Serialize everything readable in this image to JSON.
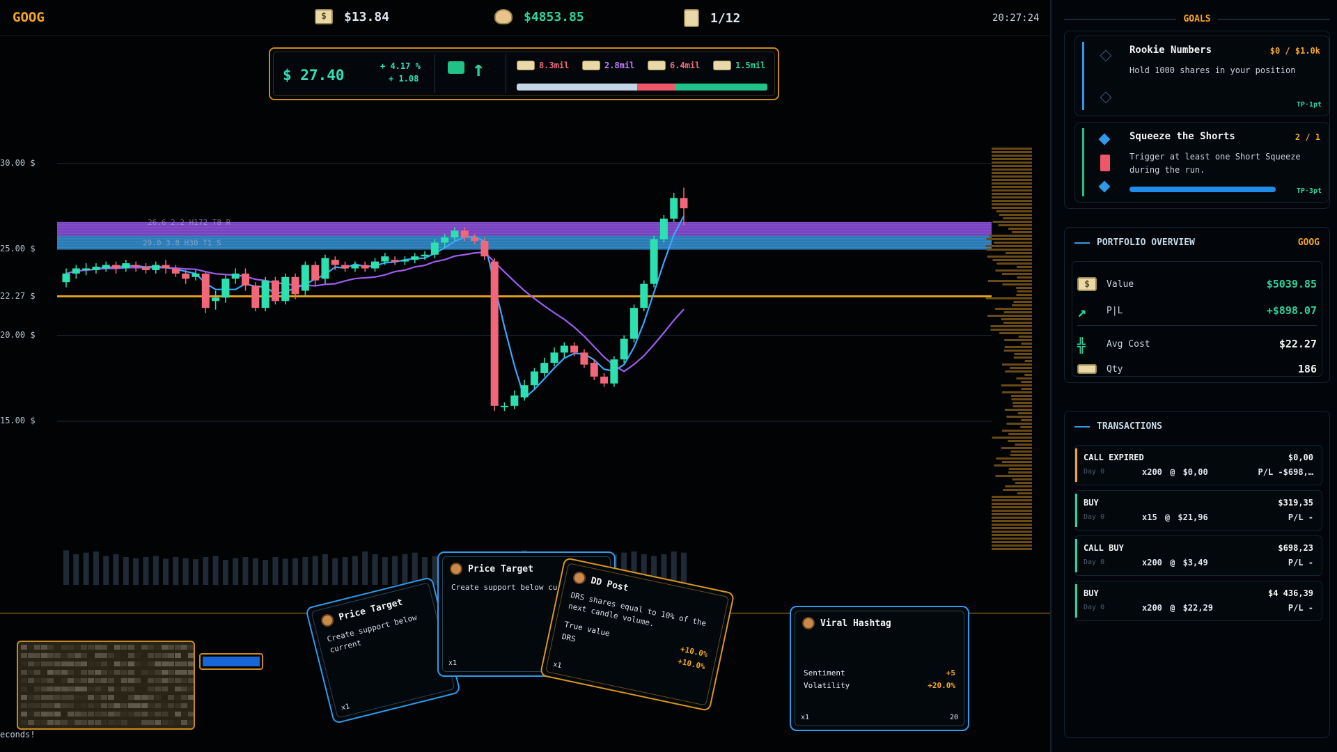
{
  "topbar": {
    "ticker": "GOOG",
    "cash": "$13.84",
    "net_worth": "$4853.85",
    "day": "1/12",
    "clock": "20:27:24",
    "icons": [
      "dollar-bill-icon",
      "money-bag-icon",
      "calendar-icon"
    ]
  },
  "price_panel": {
    "price": "$ 27.40",
    "change_pct": "+ 4.17 %",
    "change_abs": "+ 1.08",
    "trend": "up",
    "pools": [
      {
        "label": "8.3mil",
        "color": "#f06a7a"
      },
      {
        "label": "2.8mil",
        "color": "#c77dff"
      },
      {
        "label": "6.4mil",
        "color": "#f06a7a"
      },
      {
        "label": "1.5mil",
        "color": "#2fd39a"
      }
    ],
    "pool_bar": [
      {
        "fraction": 0.48,
        "color": "#c3d6e6"
      },
      {
        "fraction": 0.15,
        "color": "#f0566a"
      },
      {
        "fraction": 0.37,
        "color": "#21c287"
      }
    ]
  },
  "chart_data": {
    "type": "candlestick",
    "y_ticks": [
      {
        "value": 30,
        "label": "30.00 $"
      },
      {
        "value": 25,
        "label": "25.00 $"
      },
      {
        "value": 22.27,
        "label": "22.27 $"
      },
      {
        "value": 20,
        "label": "20.00 $"
      },
      {
        "value": 15,
        "label": "15.00 $"
      }
    ],
    "avg_cost_line": 22.27,
    "zones": [
      {
        "label": "26.6 2.2 H172 T8 R",
        "low": 25.8,
        "high": 26.6,
        "color": "#8d4ce0"
      },
      {
        "label": "29.0 3.8 H30 T1 S",
        "low": 25.0,
        "high": 25.8,
        "color": "#2f8fd6"
      }
    ],
    "candles": [
      [
        23.1,
        23.6,
        22.8,
        23.9
      ],
      [
        23.6,
        23.9,
        23.3,
        24.1
      ],
      [
        23.8,
        23.9,
        23.5,
        24.2
      ],
      [
        23.8,
        24.0,
        23.6,
        24.2
      ],
      [
        23.9,
        24.1,
        23.7,
        24.3
      ],
      [
        24.1,
        23.9,
        23.6,
        24.3
      ],
      [
        23.9,
        24.2,
        23.7,
        24.4
      ],
      [
        24.1,
        24.0,
        23.7,
        24.3
      ],
      [
        24.0,
        23.8,
        23.6,
        24.2
      ],
      [
        23.8,
        24.1,
        23.6,
        24.3
      ],
      [
        24.1,
        23.9,
        23.6,
        24.4
      ],
      [
        23.9,
        23.6,
        23.4,
        24.1
      ],
      [
        23.6,
        23.3,
        23.0,
        23.8
      ],
      [
        23.4,
        23.6,
        23.2,
        23.8
      ],
      [
        23.6,
        21.6,
        21.3,
        23.7
      ],
      [
        22.0,
        22.2,
        21.5,
        22.6
      ],
      [
        22.2,
        23.3,
        21.9,
        23.5
      ],
      [
        23.3,
        23.6,
        23.0,
        23.9
      ],
      [
        23.6,
        22.9,
        22.6,
        23.9
      ],
      [
        22.9,
        21.6,
        21.4,
        23.1
      ],
      [
        21.6,
        23.2,
        21.4,
        23.4
      ],
      [
        23.2,
        22.0,
        21.8,
        23.4
      ],
      [
        22.0,
        23.4,
        21.8,
        23.6
      ],
      [
        23.4,
        22.4,
        22.1,
        23.6
      ],
      [
        22.6,
        24.1,
        22.3,
        24.3
      ],
      [
        24.1,
        23.2,
        22.9,
        24.3
      ],
      [
        23.3,
        24.5,
        23.0,
        24.7
      ],
      [
        24.4,
        24.1,
        23.8,
        24.6
      ],
      [
        24.1,
        23.9,
        23.7,
        24.3
      ],
      [
        23.9,
        24.1,
        23.7,
        24.3
      ],
      [
        24.1,
        23.9,
        23.7,
        24.3
      ],
      [
        23.9,
        24.3,
        23.7,
        24.5
      ],
      [
        24.3,
        24.6,
        24.1,
        24.8
      ],
      [
        24.4,
        24.3,
        24.1,
        24.6
      ],
      [
        24.3,
        24.4,
        24.1,
        24.6
      ],
      [
        24.4,
        24.6,
        24.2,
        24.8
      ],
      [
        24.6,
        24.7,
        24.4,
        24.9
      ],
      [
        24.7,
        25.4,
        24.5,
        25.6
      ],
      [
        25.4,
        25.7,
        25.1,
        25.9
      ],
      [
        25.7,
        26.1,
        25.5,
        26.3
      ],
      [
        26.1,
        25.7,
        25.5,
        26.3
      ],
      [
        25.7,
        25.5,
        25.3,
        25.9
      ],
      [
        25.5,
        24.6,
        24.4,
        25.7
      ],
      [
        24.3,
        15.9,
        15.6,
        24.5
      ],
      [
        15.9,
        15.9,
        15.6,
        16.1
      ],
      [
        15.9,
        16.5,
        15.7,
        16.8
      ],
      [
        16.4,
        17.1,
        16.2,
        17.4
      ],
      [
        17.1,
        17.9,
        16.9,
        18.1
      ],
      [
        17.8,
        18.4,
        17.6,
        18.7
      ],
      [
        18.4,
        19.0,
        18.2,
        19.3
      ],
      [
        19.0,
        19.4,
        18.7,
        19.6
      ],
      [
        19.4,
        19.0,
        18.8,
        19.6
      ],
      [
        19.0,
        18.3,
        18.1,
        19.2
      ],
      [
        18.4,
        17.6,
        17.4,
        18.6
      ],
      [
        17.6,
        17.2,
        17.0,
        17.8
      ],
      [
        17.2,
        18.6,
        17.0,
        18.8
      ],
      [
        18.6,
        19.8,
        18.4,
        20.0
      ],
      [
        19.8,
        21.6,
        19.6,
        21.8
      ],
      [
        21.6,
        23.0,
        21.4,
        23.2
      ],
      [
        23.0,
        25.6,
        22.8,
        25.8
      ],
      [
        25.6,
        26.8,
        25.4,
        27.0
      ],
      [
        26.8,
        28.0,
        26.6,
        28.3
      ],
      [
        28.0,
        27.4,
        26.4,
        28.6
      ]
    ],
    "volume": [
      0.62,
      0.55,
      0.58,
      0.6,
      0.52,
      0.55,
      0.5,
      0.48,
      0.5,
      0.52,
      0.47,
      0.5,
      0.48,
      0.46,
      0.5,
      0.52,
      0.45,
      0.48,
      0.5,
      0.48,
      0.45,
      0.5,
      0.47,
      0.48,
      0.5,
      0.52,
      0.55,
      0.48,
      0.5,
      0.52,
      0.6,
      0.55,
      0.5,
      0.52,
      0.55,
      0.58,
      0.5,
      0.52,
      0.55,
      0.5,
      0.48,
      0.52,
      0.5,
      0.55,
      0.58,
      0.6,
      0.62,
      0.55,
      0.5,
      0.52,
      0.55,
      0.58,
      0.6,
      0.55,
      0.52,
      0.55,
      0.58,
      0.6,
      0.55,
      0.52,
      0.55,
      0.6,
      0.58
    ]
  },
  "cards": [
    {
      "title": "Price Target",
      "desc": "Create support below current",
      "foot": "x1"
    },
    {
      "title": "Price Target",
      "desc": "Create support below current",
      "foot": "x1"
    },
    {
      "title": "DD Post",
      "desc": "DRS shares equal to 10% of the next candle volume.",
      "rows": [
        {
          "label": "True value",
          "value": "+10.0%"
        },
        {
          "label": "DRS",
          "value": "+10.0%"
        }
      ],
      "foot": "x1"
    },
    {
      "title": "Viral Hashtag",
      "rows": [
        {
          "label": "Sentiment",
          "value": "+5"
        },
        {
          "label": "Volatility",
          "value": "+20.0%"
        }
      ],
      "foot": "x1",
      "count": "20"
    }
  ],
  "footer": {
    "status": "econds!"
  },
  "goals": {
    "header": "GOALS",
    "items": [
      {
        "name": "Rookie Numbers",
        "progress": "$0 / $1.0k",
        "desc": "Hold 1000 shares in your position",
        "reward": "TP·1pt",
        "color": "#2e9bea"
      },
      {
        "name": "Squeeze the Shorts",
        "progress": "2 / 1",
        "desc": "Trigger at least one Short Squeeze during the run.",
        "reward": "TP·3pt",
        "color": "#21c287",
        "fraction": 1.0
      }
    ]
  },
  "portfolio": {
    "header": "PORTFOLIO OVERVIEW",
    "ticker": "GOOG",
    "rows": [
      {
        "label": "Value",
        "value": "$5039.85",
        "color": "#2fd39a"
      },
      {
        "label": "P|L",
        "value": "+$898.07",
        "color": "#2fd39a"
      },
      {
        "label": "Avg Cost",
        "value": "$22.27",
        "color": "#f2f2f2"
      },
      {
        "label": "Qty",
        "value": "186",
        "color": "#f2f2f2"
      }
    ]
  },
  "transactions": {
    "header": "TRANSACTIONS",
    "items": [
      {
        "type": "CALL EXPIRED",
        "amount": "$0,00",
        "day": "Day 0",
        "qty": "x200 @ $0,00",
        "pl": "P/L -$698,…",
        "color": "#f5a623"
      },
      {
        "type": "BUY",
        "amount": "$319,35",
        "day": "Day 0",
        "qty": "x15 @ $21,96",
        "pl": "P/L -",
        "color": "#2fd39a"
      },
      {
        "type": "CALL BUY",
        "amount": "$698,23",
        "day": "Day 0",
        "qty": "x200 @ $3,49",
        "pl": "P/L -",
        "color": "#2fd39a"
      },
      {
        "type": "BUY",
        "amount": "$4 436,39",
        "day": "Day 0",
        "qty": "x200 @ $22,29",
        "pl": "P/L -",
        "color": "#2fd39a"
      }
    ]
  }
}
